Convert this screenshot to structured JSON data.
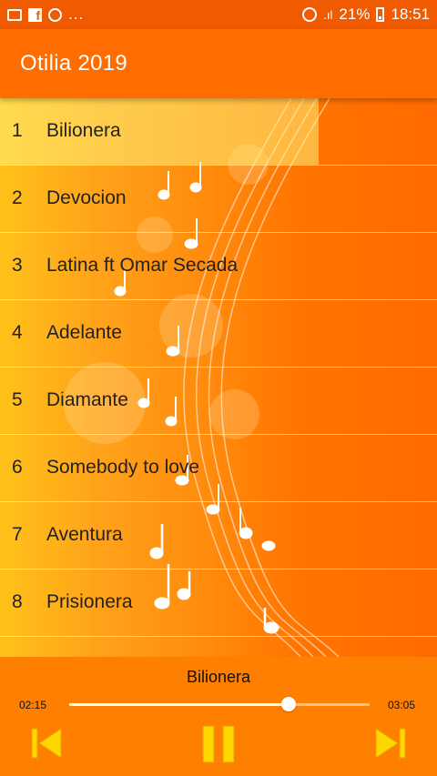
{
  "status_bar": {
    "more_indicator": "...",
    "signal": ".ıl",
    "battery": "21%",
    "time": "18:51"
  },
  "app": {
    "title": "Otilia 2019"
  },
  "songs": [
    {
      "num": "1",
      "title": "Bilionera"
    },
    {
      "num": "2",
      "title": "Devocion"
    },
    {
      "num": "3",
      "title": "Latina ft Omar Secada"
    },
    {
      "num": "4",
      "title": "Adelante"
    },
    {
      "num": "5",
      "title": "Diamante"
    },
    {
      "num": "6",
      "title": "Somebody to love"
    },
    {
      "num": "7",
      "title": "Aventura"
    },
    {
      "num": "8",
      "title": "Prisionera"
    }
  ],
  "selected_index": 0,
  "player": {
    "now_playing": "Bilionera",
    "current_time": "02:15",
    "total_time": "03:05",
    "progress": 0.73
  },
  "icons": {
    "prev": "skip-previous-icon",
    "pause": "pause-icon",
    "next": "skip-next-icon"
  },
  "colors": {
    "accent": "#ff6d00",
    "control_yellow": "#ffd600",
    "highlight": "#ffef78"
  }
}
